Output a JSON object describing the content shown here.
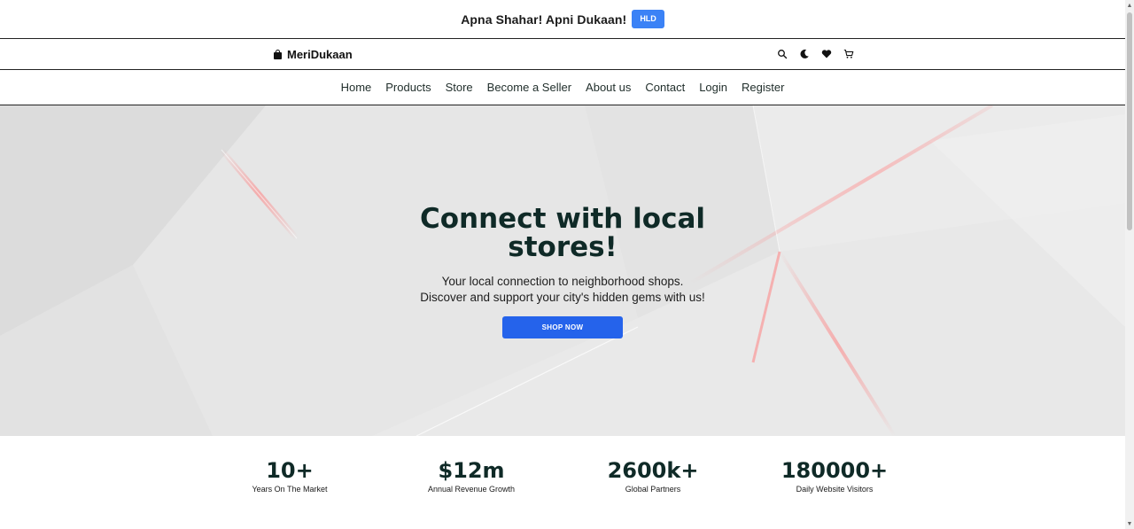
{
  "announcement": {
    "text": "Apna Shahar! Apni Dukaan!",
    "badge": "HLD"
  },
  "brand": {
    "name": "MeriDukaan",
    "icon": "shopping-bag-icon"
  },
  "header_icons": [
    "search-icon",
    "moon-icon",
    "heart-icon",
    "cart-icon"
  ],
  "nav": {
    "items": [
      {
        "label": "Home"
      },
      {
        "label": "Products"
      },
      {
        "label": "Store"
      },
      {
        "label": "Become a Seller"
      },
      {
        "label": "About us"
      },
      {
        "label": "Contact"
      },
      {
        "label": "Login"
      },
      {
        "label": "Register"
      }
    ]
  },
  "hero": {
    "title": "Connect with local stores!",
    "subtitle_line1": "Your local connection to neighborhood shops.",
    "subtitle_line2": "Discover and support your city's hidden gems with us!",
    "cta": "SHOP NOW"
  },
  "stats": [
    {
      "value": "10+",
      "label": "Years On The Market"
    },
    {
      "value": "$12m",
      "label": "Annual Revenue Growth"
    },
    {
      "value": "2600k+",
      "label": "Global Partners"
    },
    {
      "value": "180000+",
      "label": "Daily Website Visitors"
    }
  ],
  "colors": {
    "accent": "#3b82f6",
    "cta": "#2563eb",
    "heading": "#0f2a27",
    "hero_bg": "#e6e6e6"
  }
}
